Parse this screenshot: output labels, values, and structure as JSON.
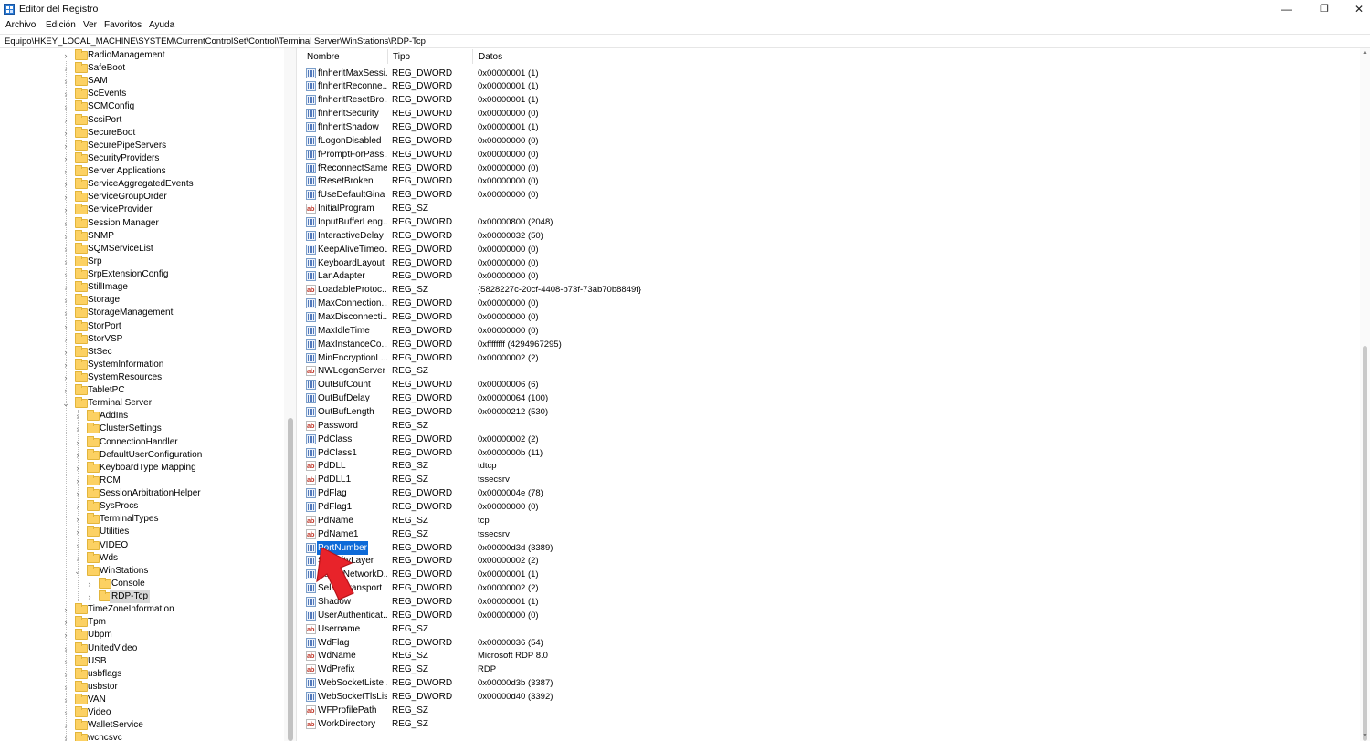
{
  "window": {
    "title": "Editor del Registro",
    "min_glyph": "—",
    "max_glyph": "❐",
    "close_glyph": "✕"
  },
  "menu": [
    "Archivo",
    "Edición",
    "Ver",
    "Favoritos",
    "Ayuda"
  ],
  "address": "Equipo\\HKEY_LOCAL_MACHINE\\SYSTEM\\CurrentControlSet\\Control\\Terminal Server\\WinStations\\RDP-Tcp",
  "tree": [
    {
      "label": "RadioManagement",
      "expanded": false
    },
    {
      "label": "SafeBoot",
      "expanded": false
    },
    {
      "label": "SAM",
      "expanded": false
    },
    {
      "label": "ScEvents",
      "expanded": false
    },
    {
      "label": "SCMConfig",
      "expanded": false
    },
    {
      "label": "ScsiPort",
      "expanded": false
    },
    {
      "label": "SecureBoot",
      "expanded": false
    },
    {
      "label": "SecurePipeServers",
      "expanded": false
    },
    {
      "label": "SecurityProviders",
      "expanded": false
    },
    {
      "label": "Server Applications",
      "expanded": false
    },
    {
      "label": "ServiceAggregatedEvents",
      "expanded": false
    },
    {
      "label": "ServiceGroupOrder",
      "expanded": false
    },
    {
      "label": "ServiceProvider",
      "expanded": false
    },
    {
      "label": "Session Manager",
      "expanded": false
    },
    {
      "label": "SNMP",
      "expanded": false
    },
    {
      "label": "SQMServiceList",
      "expanded": false
    },
    {
      "label": "Srp",
      "expanded": false
    },
    {
      "label": "SrpExtensionConfig",
      "expanded": false
    },
    {
      "label": "StillImage",
      "expanded": false
    },
    {
      "label": "Storage",
      "expanded": false
    },
    {
      "label": "StorageManagement",
      "expanded": false
    },
    {
      "label": "StorPort",
      "expanded": false
    },
    {
      "label": "StorVSP",
      "expanded": false
    },
    {
      "label": "StSec",
      "expanded": false
    },
    {
      "label": "SystemInformation",
      "expanded": false
    },
    {
      "label": "SystemResources",
      "expanded": false
    },
    {
      "label": "TabletPC",
      "expanded": false
    },
    {
      "label": "Terminal Server",
      "expanded": true
    },
    {
      "label": "AddIns",
      "expanded": false,
      "child": 1
    },
    {
      "label": "ClusterSettings",
      "expanded": false,
      "child": 1
    },
    {
      "label": "ConnectionHandler",
      "expanded": false,
      "child": 1
    },
    {
      "label": "DefaultUserConfiguration",
      "expanded": false,
      "child": 1
    },
    {
      "label": "KeyboardType Mapping",
      "expanded": false,
      "child": 1
    },
    {
      "label": "RCM",
      "expanded": false,
      "child": 1
    },
    {
      "label": "SessionArbitrationHelper",
      "expanded": false,
      "child": 1
    },
    {
      "label": "SysProcs",
      "expanded": false,
      "child": 1
    },
    {
      "label": "TerminalTypes",
      "expanded": false,
      "child": 1
    },
    {
      "label": "Utilities",
      "expanded": false,
      "child": 1
    },
    {
      "label": "VIDEO",
      "expanded": false,
      "child": 1
    },
    {
      "label": "Wds",
      "expanded": false,
      "child": 1
    },
    {
      "label": "WinStations",
      "expanded": true,
      "child": 1
    },
    {
      "label": "Console",
      "expanded": false,
      "child": 2
    },
    {
      "label": "RDP-Tcp",
      "expanded": false,
      "child": 2,
      "selected": true
    },
    {
      "label": "TimeZoneInformation",
      "expanded": false
    },
    {
      "label": "Tpm",
      "expanded": false
    },
    {
      "label": "Ubpm",
      "expanded": false
    },
    {
      "label": "UnitedVideo",
      "expanded": false
    },
    {
      "label": "USB",
      "expanded": false
    },
    {
      "label": "usbflags",
      "expanded": false
    },
    {
      "label": "usbstor",
      "expanded": false
    },
    {
      "label": "VAN",
      "expanded": false
    },
    {
      "label": "Video",
      "expanded": false
    },
    {
      "label": "WalletService",
      "expanded": false
    },
    {
      "label": "wcncsvc",
      "expanded": false
    }
  ],
  "columns": {
    "name": "Nombre",
    "type": "Tipo",
    "data": "Datos"
  },
  "values": [
    {
      "name": "fInheritMaxSessi...",
      "type": "REG_DWORD",
      "data": "0x00000001 (1)"
    },
    {
      "name": "fInheritReconne...",
      "type": "REG_DWORD",
      "data": "0x00000001 (1)"
    },
    {
      "name": "fInheritResetBro...",
      "type": "REG_DWORD",
      "data": "0x00000001 (1)"
    },
    {
      "name": "fInheritSecurity",
      "type": "REG_DWORD",
      "data": "0x00000000 (0)"
    },
    {
      "name": "fInheritShadow",
      "type": "REG_DWORD",
      "data": "0x00000001 (1)"
    },
    {
      "name": "fLogonDisabled",
      "type": "REG_DWORD",
      "data": "0x00000000 (0)"
    },
    {
      "name": "fPromptForPass...",
      "type": "REG_DWORD",
      "data": "0x00000000 (0)"
    },
    {
      "name": "fReconnectSame",
      "type": "REG_DWORD",
      "data": "0x00000000 (0)"
    },
    {
      "name": "fResetBroken",
      "type": "REG_DWORD",
      "data": "0x00000000 (0)"
    },
    {
      "name": "fUseDefaultGina",
      "type": "REG_DWORD",
      "data": "0x00000000 (0)"
    },
    {
      "name": "InitialProgram",
      "type": "REG_SZ",
      "data": ""
    },
    {
      "name": "InputBufferLeng...",
      "type": "REG_DWORD",
      "data": "0x00000800 (2048)"
    },
    {
      "name": "InteractiveDelay",
      "type": "REG_DWORD",
      "data": "0x00000032 (50)"
    },
    {
      "name": "KeepAliveTimeout",
      "type": "REG_DWORD",
      "data": "0x00000000 (0)"
    },
    {
      "name": "KeyboardLayout",
      "type": "REG_DWORD",
      "data": "0x00000000 (0)"
    },
    {
      "name": "LanAdapter",
      "type": "REG_DWORD",
      "data": "0x00000000 (0)"
    },
    {
      "name": "LoadableProtoc...",
      "type": "REG_SZ",
      "data": "{5828227c-20cf-4408-b73f-73ab70b8849f}"
    },
    {
      "name": "MaxConnection...",
      "type": "REG_DWORD",
      "data": "0x00000000 (0)"
    },
    {
      "name": "MaxDisconnecti...",
      "type": "REG_DWORD",
      "data": "0x00000000 (0)"
    },
    {
      "name": "MaxIdleTime",
      "type": "REG_DWORD",
      "data": "0x00000000 (0)"
    },
    {
      "name": "MaxInstanceCo...",
      "type": "REG_DWORD",
      "data": "0xffffffff (4294967295)"
    },
    {
      "name": "MinEncryptionL...",
      "type": "REG_DWORD",
      "data": "0x00000002 (2)"
    },
    {
      "name": "NWLogonServer",
      "type": "REG_SZ",
      "data": ""
    },
    {
      "name": "OutBufCount",
      "type": "REG_DWORD",
      "data": "0x00000006 (6)"
    },
    {
      "name": "OutBufDelay",
      "type": "REG_DWORD",
      "data": "0x00000064 (100)"
    },
    {
      "name": "OutBufLength",
      "type": "REG_DWORD",
      "data": "0x00000212 (530)"
    },
    {
      "name": "Password",
      "type": "REG_SZ",
      "data": ""
    },
    {
      "name": "PdClass",
      "type": "REG_DWORD",
      "data": "0x00000002 (2)"
    },
    {
      "name": "PdClass1",
      "type": "REG_DWORD",
      "data": "0x0000000b (11)"
    },
    {
      "name": "PdDLL",
      "type": "REG_SZ",
      "data": "tdtcp"
    },
    {
      "name": "PdDLL1",
      "type": "REG_SZ",
      "data": "tssecsrv"
    },
    {
      "name": "PdFlag",
      "type": "REG_DWORD",
      "data": "0x0000004e (78)"
    },
    {
      "name": "PdFlag1",
      "type": "REG_DWORD",
      "data": "0x00000000 (0)"
    },
    {
      "name": "PdName",
      "type": "REG_SZ",
      "data": "tcp"
    },
    {
      "name": "PdName1",
      "type": "REG_SZ",
      "data": "tssecsrv"
    },
    {
      "name": "PortNumber",
      "type": "REG_DWORD",
      "data": "0x00000d3d (3389)",
      "selected": true
    },
    {
      "name": "SecurityLayer",
      "type": "REG_DWORD",
      "data": "0x00000002 (2)"
    },
    {
      "name": "SelectNetworkD...",
      "type": "REG_DWORD",
      "data": "0x00000001 (1)"
    },
    {
      "name": "SelectTransport",
      "type": "REG_DWORD",
      "data": "0x00000002 (2)"
    },
    {
      "name": "Shadow",
      "type": "REG_DWORD",
      "data": "0x00000001 (1)"
    },
    {
      "name": "UserAuthenticat...",
      "type": "REG_DWORD",
      "data": "0x00000000 (0)"
    },
    {
      "name": "Username",
      "type": "REG_SZ",
      "data": ""
    },
    {
      "name": "WdFlag",
      "type": "REG_DWORD",
      "data": "0x00000036 (54)"
    },
    {
      "name": "WdName",
      "type": "REG_SZ",
      "data": "Microsoft RDP 8.0"
    },
    {
      "name": "WdPrefix",
      "type": "REG_SZ",
      "data": "RDP"
    },
    {
      "name": "WebSocketListe...",
      "type": "REG_DWORD",
      "data": "0x00000d3b (3387)"
    },
    {
      "name": "WebSocketTlsLis...",
      "type": "REG_DWORD",
      "data": "0x00000d40 (3392)"
    },
    {
      "name": "WFProfilePath",
      "type": "REG_SZ",
      "data": ""
    },
    {
      "name": "WorkDirectory",
      "type": "REG_SZ",
      "data": ""
    }
  ],
  "colors": {
    "selection": "#0d6ad8",
    "arrow": "#e8232a",
    "folder": "#fcd163"
  }
}
